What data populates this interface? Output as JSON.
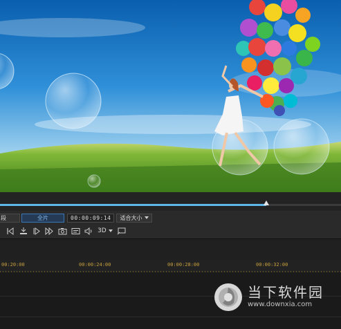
{
  "preview": {
    "description_icon": "video-preview"
  },
  "scrubber": {
    "progress_fraction": 0.78
  },
  "controls": {
    "mode_left_label": "段",
    "mode_active_label": "全片",
    "timecode": "00:00:09:14",
    "fit_select": "适合大小",
    "mode_3d_label": "3D"
  },
  "icons": [
    "prev-frame-icon",
    "mark-in-icon",
    "play-icon",
    "next-frame-icon",
    "snapshot-icon",
    "caption-icon",
    "volume-icon",
    "chevron-down-icon",
    "external-display-icon"
  ],
  "ruler": {
    "labels": [
      "00:20:00",
      "00:00:24:00",
      "00:00:28:00",
      "00:00:32:00"
    ]
  },
  "watermark": {
    "brand": "当下软件园",
    "url": "www.downxia.com"
  },
  "colors": {
    "accent": "#5fb6e8",
    "ruler_text": "#c8a040"
  }
}
